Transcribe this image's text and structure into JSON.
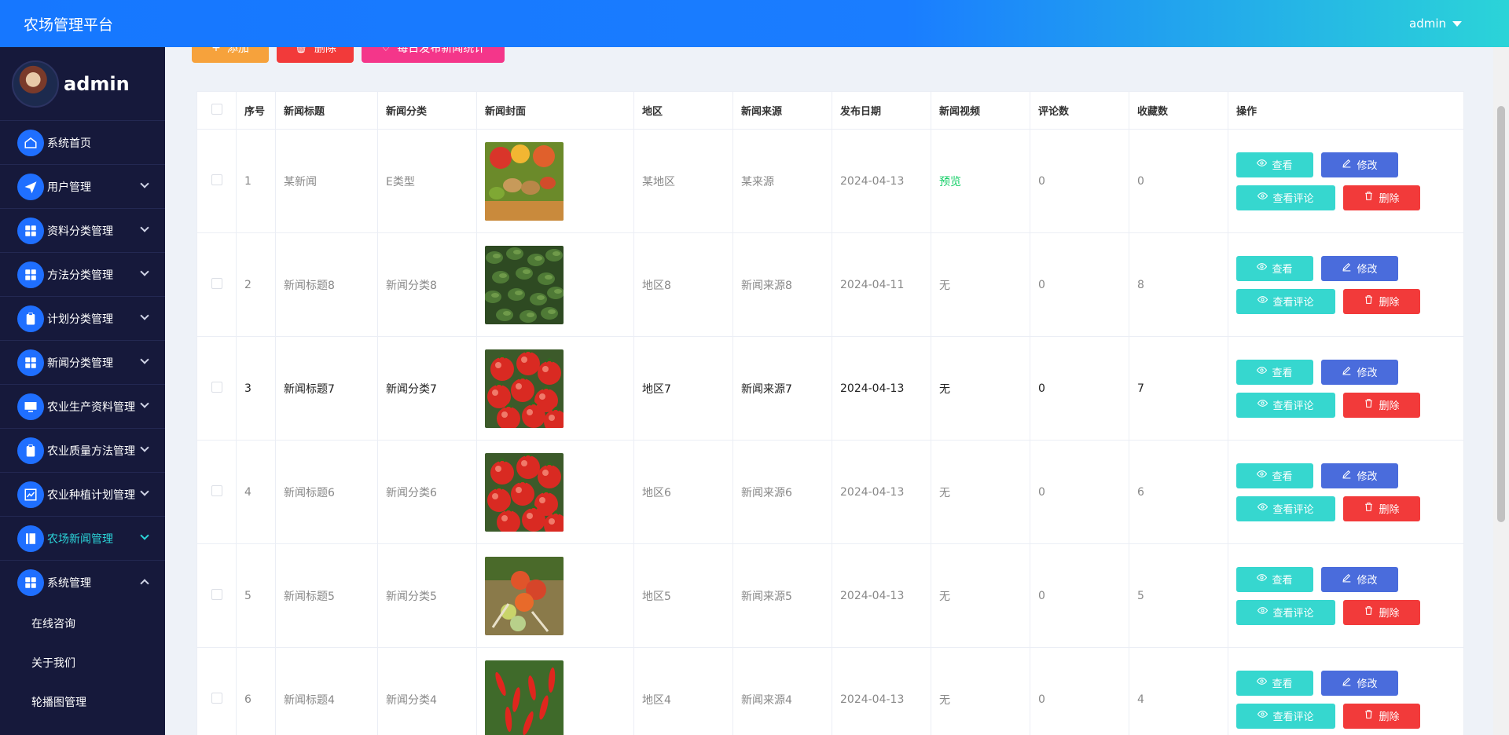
{
  "header": {
    "title": "农场管理平台",
    "user": "admin"
  },
  "sidebar": {
    "profile_name": "admin",
    "items": [
      {
        "label": "系统首页",
        "icon": "home-icon",
        "has_chevron": false
      },
      {
        "label": "用户管理",
        "icon": "send-icon",
        "has_chevron": true
      },
      {
        "label": "资料分类管理",
        "icon": "grid-icon",
        "has_chevron": true
      },
      {
        "label": "方法分类管理",
        "icon": "grid-icon",
        "has_chevron": true
      },
      {
        "label": "计划分类管理",
        "icon": "clipboard-icon",
        "has_chevron": true
      },
      {
        "label": "新闻分类管理",
        "icon": "grid-icon",
        "has_chevron": true
      },
      {
        "label": "农业生产资料管理",
        "icon": "monitor-icon",
        "has_chevron": true
      },
      {
        "label": "农业质量方法管理",
        "icon": "clipboard-icon",
        "has_chevron": true
      },
      {
        "label": "农业种植计划管理",
        "icon": "chart-icon",
        "has_chevron": true
      },
      {
        "label": "农场新闻管理",
        "icon": "book-icon",
        "has_chevron": true,
        "active": true
      },
      {
        "label": "系统管理",
        "icon": "grid-icon",
        "has_chevron": true,
        "expanded": true
      }
    ],
    "sub_items": [
      "在线咨询",
      "关于我们",
      "轮播图管理"
    ]
  },
  "toolbar": {
    "add_label": "添加",
    "delete_label": "删除",
    "stat_label": "每日发布新闻统计"
  },
  "table": {
    "columns": [
      "序号",
      "新闻标题",
      "新闻分类",
      "新闻封面",
      "地区",
      "新闻来源",
      "发布日期",
      "新闻视频",
      "评论数",
      "收藏数",
      "操作"
    ],
    "rows": [
      {
        "index": "1",
        "title": "某新闻",
        "category": "E类型",
        "cover": "vegetables",
        "region": "某地区",
        "source": "某来源",
        "date": "2024-04-13",
        "video": "预览",
        "comments": "0",
        "favorites": "0"
      },
      {
        "index": "2",
        "title": "新闻标题8",
        "category": "新闻分类8",
        "cover": "greens",
        "region": "地区8",
        "source": "新闻来源8",
        "date": "2024-04-11",
        "video": "无",
        "comments": "0",
        "favorites": "8"
      },
      {
        "index": "3",
        "title": "新闻标题7",
        "category": "新闻分类7",
        "cover": "tomatoes",
        "region": "地区7",
        "source": "新闻来源7",
        "date": "2024-04-13",
        "video": "无",
        "comments": "0",
        "favorites": "7",
        "highlight": true
      },
      {
        "index": "4",
        "title": "新闻标题6",
        "category": "新闻分类6",
        "cover": "tomatoes",
        "region": "地区6",
        "source": "新闻来源6",
        "date": "2024-04-13",
        "video": "无",
        "comments": "0",
        "favorites": "6"
      },
      {
        "index": "5",
        "title": "新闻标题5",
        "category": "新闻分类5",
        "cover": "tomato-vine",
        "region": "地区5",
        "source": "新闻来源5",
        "date": "2024-04-13",
        "video": "无",
        "comments": "0",
        "favorites": "5"
      },
      {
        "index": "6",
        "title": "新闻标题4",
        "category": "新闻分类4",
        "cover": "peppers",
        "region": "地区4",
        "source": "新闻来源4",
        "date": "2024-04-13",
        "video": "无",
        "comments": "0",
        "favorites": "4"
      }
    ],
    "actions": {
      "view": "查看",
      "edit": "修改",
      "comments": "查看评论",
      "delete": "删除"
    }
  },
  "colors": {
    "header_start": "#1677ff",
    "header_end": "#2bd4d8",
    "sidebar_bg": "#16193b",
    "active_menu": "#2bd4d8",
    "view_btn": "#36d7cf",
    "edit_btn": "#4a6cdc",
    "delete_btn": "#f23a3a"
  }
}
